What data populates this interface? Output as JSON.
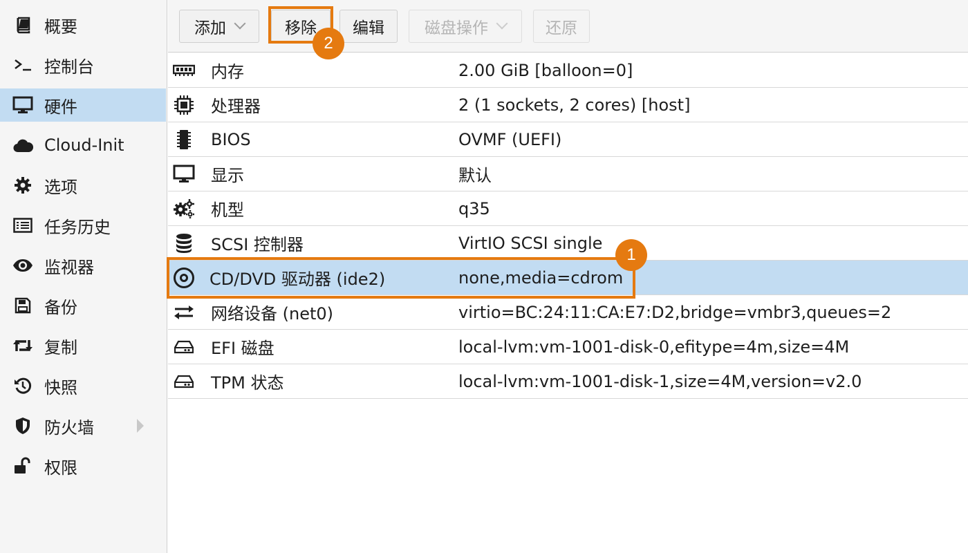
{
  "sidebar": {
    "items": [
      {
        "label": "概要",
        "icon": "book-icon"
      },
      {
        "label": "控制台",
        "icon": "terminal-icon"
      },
      {
        "label": "硬件",
        "icon": "monitor-icon",
        "selected": true
      },
      {
        "label": "Cloud-Init",
        "icon": "cloud-icon"
      },
      {
        "label": "选项",
        "icon": "gear-icon"
      },
      {
        "label": "任务历史",
        "icon": "list-icon"
      },
      {
        "label": "监视器",
        "icon": "eye-icon"
      },
      {
        "label": "备份",
        "icon": "floppy-icon"
      },
      {
        "label": "复制",
        "icon": "retweet-icon"
      },
      {
        "label": "快照",
        "icon": "history-icon"
      },
      {
        "label": "防火墙",
        "icon": "shield-icon",
        "has_submenu": true
      },
      {
        "label": "权限",
        "icon": "unlock-icon"
      }
    ]
  },
  "toolbar": {
    "add_label": "添加",
    "remove_label": "移除",
    "edit_label": "编辑",
    "disk_action_label": "磁盘操作",
    "revert_label": "还原"
  },
  "hardware": {
    "rows": [
      {
        "name": "内存",
        "value": "2.00 GiB [balloon=0]",
        "icon": "memory-icon"
      },
      {
        "name": "处理器",
        "value": "2 (1 sockets, 2 cores) [host]",
        "icon": "cpu-icon"
      },
      {
        "name": "BIOS",
        "value": "OVMF (UEFI)",
        "icon": "microchip-icon"
      },
      {
        "name": "显示",
        "value": "默认",
        "icon": "desktop-icon"
      },
      {
        "name": "机型",
        "value": "q35",
        "icon": "cogs-icon"
      },
      {
        "name": "SCSI 控制器",
        "value": "VirtIO SCSI single",
        "icon": "database-icon"
      },
      {
        "name": "CD/DVD 驱动器 (ide2)",
        "value": "none,media=cdrom",
        "icon": "disc-icon",
        "selected": true
      },
      {
        "name": "网络设备 (net0)",
        "value": "virtio=BC:24:11:CA:E7:D2,bridge=vmbr3,queues=2",
        "icon": "exchange-icon"
      },
      {
        "name": "EFI 磁盘",
        "value": "local-lvm:vm-1001-disk-0,efitype=4m,size=4M",
        "icon": "hdd-icon"
      },
      {
        "name": "TPM 状态",
        "value": "local-lvm:vm-1001-disk-1,size=4M,version=v2.0",
        "icon": "hdd-icon"
      }
    ]
  },
  "annotations": {
    "step1": "1",
    "step2": "2",
    "color": "#e57a10"
  },
  "colors": {
    "selected_bg": "#c2dcf2",
    "sidebar_bg": "#f5f5f5"
  }
}
